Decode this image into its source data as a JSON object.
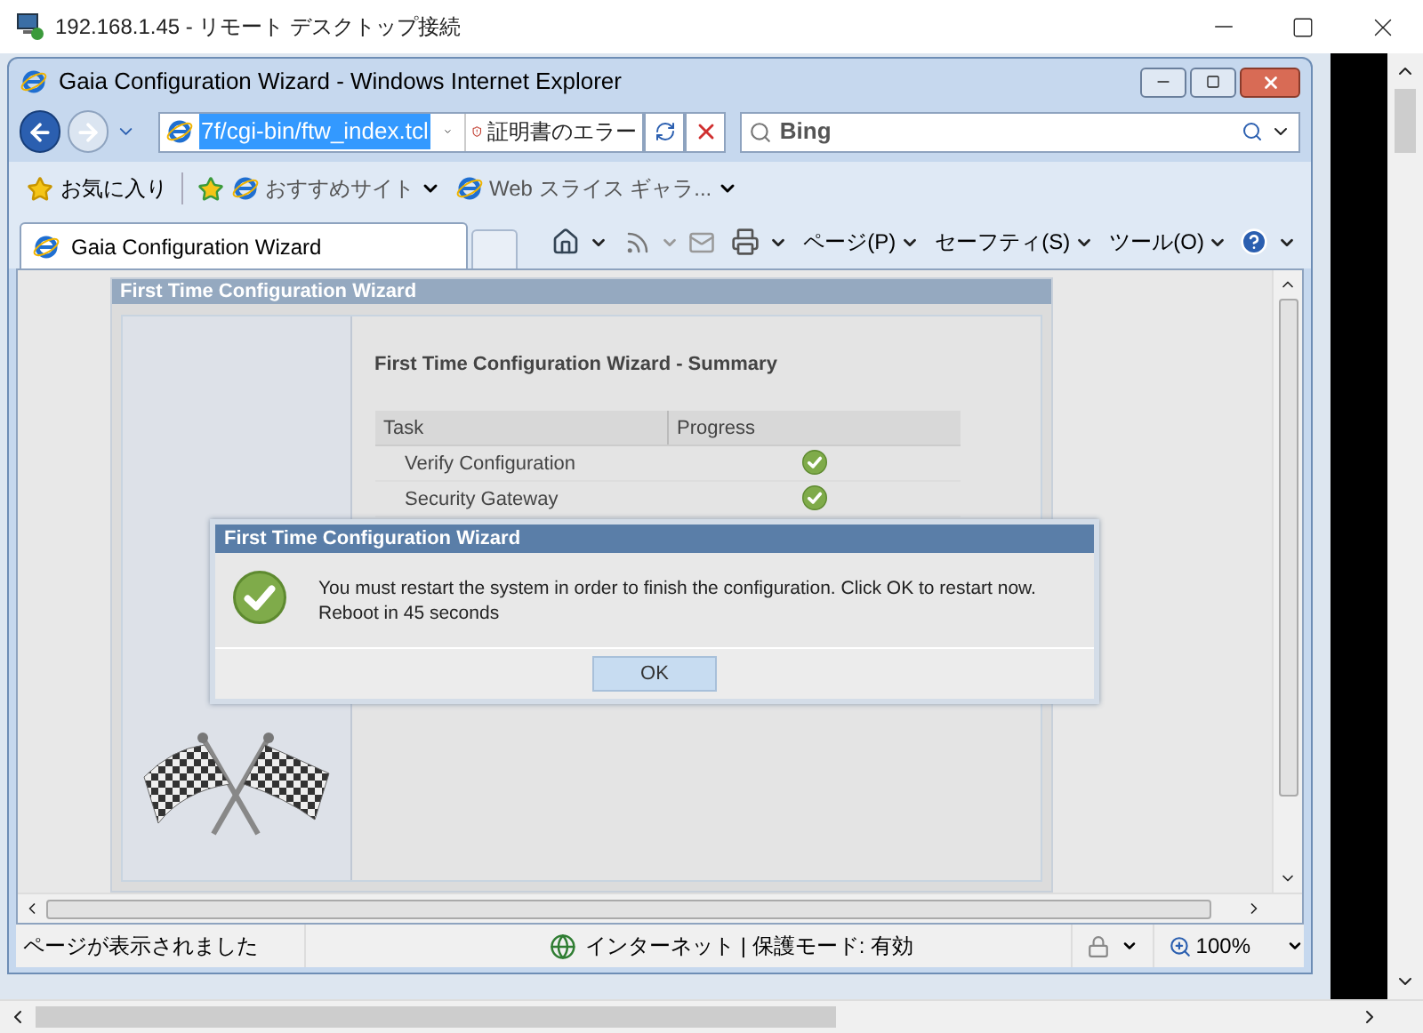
{
  "rdp_window": {
    "title": "192.168.1.45 - リモート デスクトップ接続"
  },
  "browser": {
    "title": "Gaia Configuration Wizard - Windows Internet Explorer",
    "address": {
      "text": "7f/cgi-bin/ftw_index.tcl",
      "selected": true
    },
    "certificate_error": "証明書のエラー",
    "search_placeholder": "Bing"
  },
  "favorites_bar": {
    "favorites": "お気に入り",
    "links": [
      "おすすめサイト",
      "Web スライス ギャラ..."
    ]
  },
  "tabs": [
    {
      "label": "Gaia Configuration Wizard",
      "selected": true
    }
  ],
  "command_bar": [
    "ページ(P)",
    "セーフティ(S)",
    "ツール(O)"
  ],
  "page": {
    "panel_title": "First Time Configuration Wizard",
    "summary_title": "First Time Configuration Wizard - Summary",
    "columns": [
      "Task",
      "Progress"
    ],
    "rows": [
      {
        "task": "Verify Configuration",
        "done": true
      },
      {
        "task": "Security Gateway",
        "done": true
      }
    ]
  },
  "dialog": {
    "title": "First Time Configuration Wizard",
    "message": "You must restart the system in order to finish the configuration. Click OK to restart now.",
    "countdown": "Reboot in 45 seconds",
    "button": "OK"
  },
  "status_bar": {
    "status": "ページが表示されました",
    "zone": "インターネット | 保護モード: 有効",
    "zoom": "100%"
  }
}
